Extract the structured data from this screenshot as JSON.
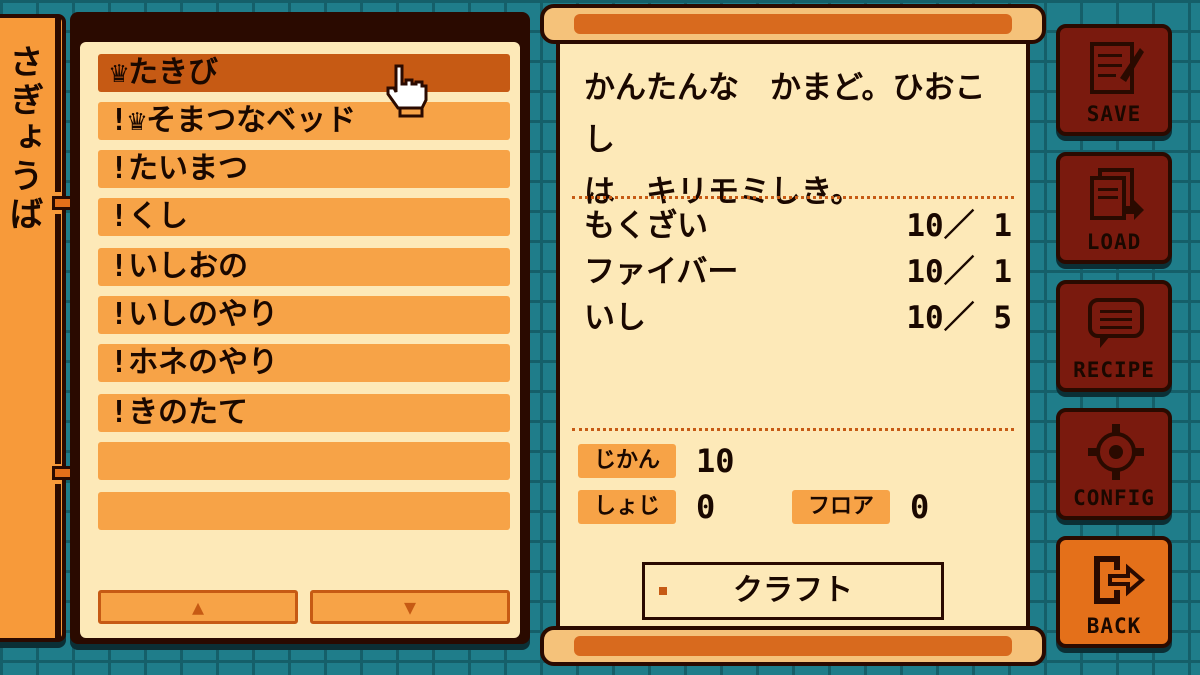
{
  "sidebar": {
    "title": "さぎょうば"
  },
  "list": {
    "items": [
      {
        "label": "たきび",
        "prefix": "♛",
        "selected": true
      },
      {
        "label": "そまつなベッド",
        "prefix": "!♛",
        "selected": false
      },
      {
        "label": "たいまつ",
        "prefix": "!",
        "selected": false
      },
      {
        "label": "くし",
        "prefix": "!",
        "selected": false
      },
      {
        "label": "いしおの",
        "prefix": "!",
        "selected": false
      },
      {
        "label": "いしのやり",
        "prefix": "!",
        "selected": false
      },
      {
        "label": "ホネのやり",
        "prefix": "!",
        "selected": false
      },
      {
        "label": "きのたて",
        "prefix": "!",
        "selected": false
      },
      {
        "label": "",
        "prefix": "",
        "selected": false
      },
      {
        "label": "",
        "prefix": "",
        "selected": false
      }
    ],
    "up_label": "▲",
    "down_label": "▼"
  },
  "detail": {
    "description_line1": "かんたんな　かまど。ひおこし",
    "description_line2": "は　キリモミしき。",
    "materials": [
      {
        "name": "もくざい",
        "qty": "10／ 1"
      },
      {
        "name": "ファイバー",
        "qty": "10／ 1"
      },
      {
        "name": "いし",
        "qty": "10／ 5"
      }
    ],
    "time_label": "じかん",
    "time_value": "10",
    "owned_label": "しょじ",
    "owned_value": "0",
    "floor_label": "フロア",
    "floor_value": "0",
    "craft_label": "クラフト"
  },
  "menu": {
    "save": "SAVE",
    "load": "LOAD",
    "recipe": "RECIPE",
    "config": "CONFIG",
    "back": "BACK"
  },
  "colors": {
    "background": "#1f7d8a",
    "panel_dark": "#2a0a00",
    "paper": "#fde9b8",
    "row": "#f7a347",
    "row_selected": "#c65a14",
    "menu_button": "#7a1a0e",
    "back_button": "#e4701a"
  },
  "icons": {
    "save": "notepad-pencil-icon",
    "load": "documents-arrow-icon",
    "recipe": "speech-bubble-icon",
    "config": "gear-icon",
    "back": "exit-arrow-icon",
    "cursor": "pointing-hand-icon"
  }
}
